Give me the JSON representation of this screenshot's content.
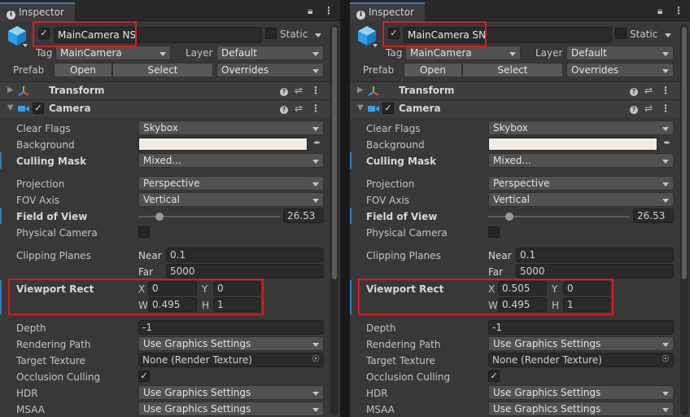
{
  "panels": [
    {
      "tab": "Inspector",
      "object_name": "MainCamera NS",
      "static_label": "Static",
      "tag_label": "Tag",
      "tag_value": "MainCamera",
      "layer_label": "Layer",
      "layer_value": "Default",
      "prefab_label": "Prefab",
      "open_label": "Open",
      "select_label": "Select",
      "overrides_label": "Overrides",
      "transform": "Transform",
      "camera": "Camera",
      "clear_flags": "Clear Flags",
      "clear_flags_value": "Skybox",
      "background": "Background",
      "culling_mask": "Culling Mask",
      "culling_mask_value": "Mixed...",
      "projection": "Projection",
      "projection_value": "Perspective",
      "fov_axis": "FOV Axis",
      "fov_axis_value": "Vertical",
      "field_of_view": "Field of View",
      "fov_value": "26.53",
      "fov_slider_fraction": 0.15,
      "physical_camera": "Physical Camera",
      "clipping_planes": "Clipping Planes",
      "near_label": "Near",
      "near_value": "0.1",
      "far_label": "Far",
      "far_value": "5000",
      "viewport_rect": "Viewport Rect",
      "x_label": "X",
      "x_value": "0",
      "y_label": "Y",
      "y_value": "0",
      "w_label": "W",
      "w_value": "0.495",
      "h_label": "H",
      "h_value": "1",
      "depth": "Depth",
      "depth_value": "-1",
      "rendering_path": "Rendering Path",
      "rendering_path_value": "Use Graphics Settings",
      "target_texture": "Target Texture",
      "target_texture_value": "None (Render Texture)",
      "occlusion_culling": "Occlusion Culling",
      "hdr": "HDR",
      "hdr_value": "Use Graphics Settings",
      "msaa": "MSAA",
      "msaa_value": "Use Graphics Settings"
    },
    {
      "tab": "Inspector",
      "object_name": "MainCamera SN",
      "static_label": "Static",
      "tag_label": "Tag",
      "tag_value": "MainCamera",
      "layer_label": "Layer",
      "layer_value": "Default",
      "prefab_label": "Prefab",
      "open_label": "Open",
      "select_label": "Select",
      "overrides_label": "Overrides",
      "transform": "Transform",
      "camera": "Camera",
      "clear_flags": "Clear Flags",
      "clear_flags_value": "Skybox",
      "background": "Background",
      "culling_mask": "Culling Mask",
      "culling_mask_value": "Mixed...",
      "projection": "Projection",
      "projection_value": "Perspective",
      "fov_axis": "FOV Axis",
      "fov_axis_value": "Vertical",
      "field_of_view": "Field of View",
      "fov_value": "26.53",
      "fov_slider_fraction": 0.15,
      "physical_camera": "Physical Camera",
      "clipping_planes": "Clipping Planes",
      "near_label": "Near",
      "near_value": "0.1",
      "far_label": "Far",
      "far_value": "5000",
      "viewport_rect": "Viewport Rect",
      "x_label": "X",
      "x_value": "0.505",
      "y_label": "Y",
      "y_value": "0",
      "w_label": "W",
      "w_value": "0.495",
      "h_label": "H",
      "h_value": "1",
      "depth": "Depth",
      "depth_value": "-1",
      "rendering_path": "Rendering Path",
      "rendering_path_value": "Use Graphics Settings",
      "target_texture": "Target Texture",
      "target_texture_value": "None (Render Texture)",
      "occlusion_culling": "Occlusion Culling",
      "hdr": "HDR",
      "hdr_value": "Use Graphics Settings",
      "msaa": "MSAA",
      "msaa_value": "Use Graphics Settings"
    }
  ],
  "colors": {
    "highlight": "#dd1a22",
    "accent": "#3a79bb",
    "background_swatch": "#f1ede0"
  },
  "icons": [
    "info-icon",
    "lock-icon",
    "kebab-menu-icon",
    "gameobject-cube-icon",
    "transform-axes-icon",
    "camera-icon",
    "help-icon",
    "preset-sliders-icon",
    "color-picker-icon",
    "object-picker-icon"
  ]
}
